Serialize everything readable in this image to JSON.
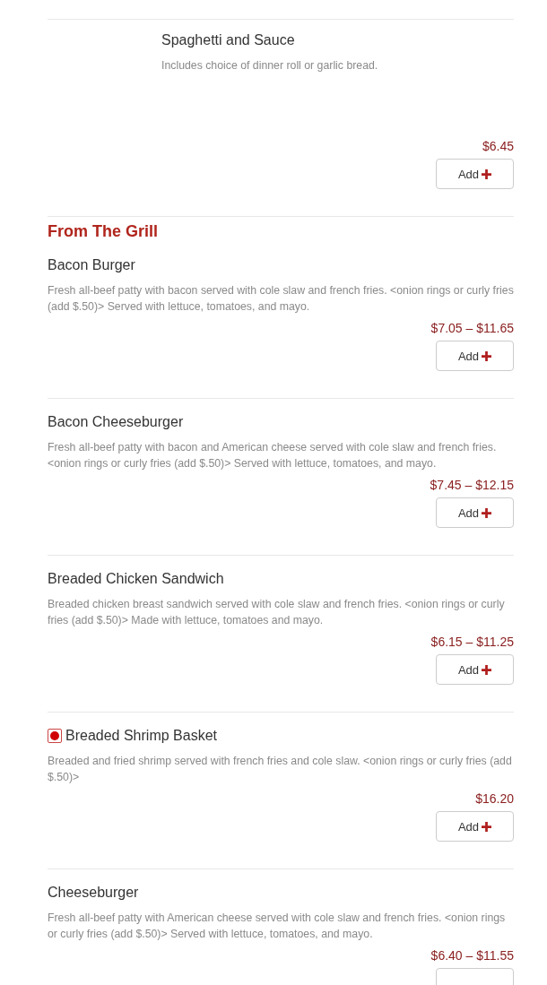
{
  "sections": [
    {
      "items": [
        {
          "kind": "indented",
          "name": "Spaghetti and Sauce",
          "description": "Includes choice of dinner roll or garlic bread.",
          "price": "$6.45",
          "add_label": "Add"
        }
      ]
    },
    {
      "heading": "From The Grill",
      "items": [
        {
          "kind": "plain",
          "name": "Bacon Burger",
          "description": "Fresh all-beef patty with bacon served with cole slaw and french fries.  <onion rings or curly fries (add $.50)>  Served with lettuce, tomatoes, and mayo.",
          "price": "$7.05 – $11.65",
          "add_label": "Add"
        },
        {
          "kind": "plain",
          "name": "Bacon Cheeseburger",
          "description": "Fresh all-beef patty with bacon and American cheese served with cole slaw and french fries.  <onion rings or curly fries (add $.50)>  Served with lettuce, tomatoes, and mayo.",
          "price": "$7.45 – $12.15",
          "add_label": "Add"
        },
        {
          "kind": "plain",
          "name": "Breaded Chicken Sandwich",
          "description": "Breaded chicken breast sandwich served with cole slaw and french fries.  <onion rings or curly fries (add $.50)>  Made with lettuce, tomatoes and mayo.",
          "price": "$6.15 – $11.25",
          "add_label": "Add"
        },
        {
          "kind": "plain",
          "marked": true,
          "name": "Breaded Shrimp Basket",
          "description": "Breaded and fried shrimp served with french fries and cole slaw. <onion rings or curly fries (add $.50)>",
          "price": "$16.20",
          "add_label": "Add"
        },
        {
          "kind": "plain",
          "name": "Cheeseburger",
          "description": "Fresh all-beef patty with American cheese served with cole slaw and french fries.  <onion rings or curly fries (add $.50)>  Served with lettuce, tomatoes, and mayo.",
          "price": "$6.40 – $11.55"
        }
      ]
    }
  ]
}
